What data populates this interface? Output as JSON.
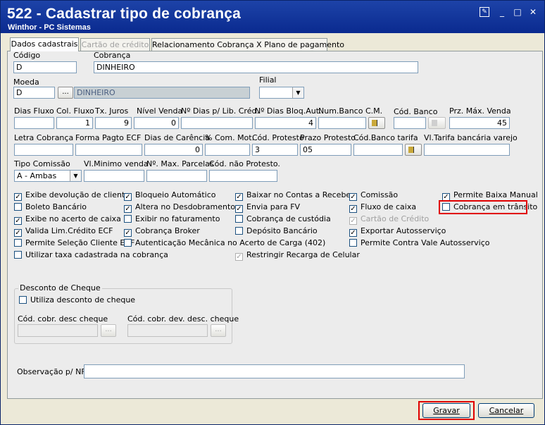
{
  "window": {
    "title": "522 - Cadastrar tipo de cobrança",
    "subtitle": "Winthor - PC Sistemas"
  },
  "tabs": [
    "Dados cadastrais",
    "Cartão de crédito",
    "Relacionamento Cobrança X Plano de pagamento"
  ],
  "fields": {
    "codigo": {
      "label": "Código",
      "value": "D"
    },
    "cobranca": {
      "label": "Cobrança",
      "value": "DINHEIRO"
    },
    "moeda": {
      "label": "Moeda",
      "value": "D",
      "desc": "DINHEIRO"
    },
    "filial": {
      "label": "Filial",
      "value": ""
    },
    "dias_fluxo": {
      "label": "Dias Fluxo",
      "value": ""
    },
    "col_fluxo": {
      "label": "Col. Fluxo",
      "value": "1"
    },
    "tx_juros": {
      "label": "Tx. Juros",
      "value": "9"
    },
    "nivel_venda": {
      "label": "Nível Venda",
      "value": "0"
    },
    "dias_lib_cred": {
      "label": "Nº Dias p/ Lib. Créd.",
      "value": ""
    },
    "dias_bloq_aut": {
      "label": "Nº Dias Bloq.Aut.",
      "value": "4"
    },
    "num_banco_cm": {
      "label": "Num.Banco C.M.",
      "value": ""
    },
    "cod_banco": {
      "label": "Cód. Banco",
      "value": ""
    },
    "prz_max_venda": {
      "label": "Prz. Máx. Venda",
      "value": "45"
    },
    "letra_cobranca": {
      "label": "Letra Cobrança",
      "value": ""
    },
    "forma_pagto_ecf": {
      "label": "Forma Pagto ECF",
      "value": ""
    },
    "dias_carencia": {
      "label": "Dias de Carência",
      "value": "0"
    },
    "com_mot": {
      "label": "% Com. Mot.",
      "value": ""
    },
    "cod_protesto": {
      "label": "Cód. Protesto",
      "value": "3"
    },
    "prazo_protesto": {
      "label": "Prazo Protesto",
      "value": "05"
    },
    "cod_banco_tarifa": {
      "label": "Cód.Banco tarifa",
      "value": ""
    },
    "vl_tarifa_bancaria": {
      "label": "Vl.Tarifa bancária varejo",
      "value": ""
    },
    "tipo_comissao": {
      "label": "Tipo Comissão",
      "value": "A - Ambas"
    },
    "vl_minimo_venda": {
      "label": "Vl.Minimo venda",
      "value": ""
    },
    "max_parcelas": {
      "label": "Nº. Max. Parcelas",
      "value": ""
    },
    "cod_nao_protesto": {
      "label": "Cód. não  Protesto.",
      "value": ""
    },
    "observacao_nf": {
      "label": "Observação p/ NF:",
      "value": ""
    }
  },
  "checkboxes": [
    {
      "label": "Exibe devolução de cliente",
      "checked": true,
      "disabled": false
    },
    {
      "label": "Boleto Bancário",
      "checked": false,
      "disabled": false
    },
    {
      "label": "Exibe no acerto de caixa",
      "checked": true,
      "disabled": false
    },
    {
      "label": "Valida Lim.Crédito ECF",
      "checked": true,
      "disabled": false
    },
    {
      "label": "Permite Seleção Cliente ECF",
      "checked": false,
      "disabled": false
    },
    {
      "label": "Utilizar taxa cadastrada na cobrança",
      "checked": false,
      "disabled": false
    },
    {
      "label": "Bloqueio Automático",
      "checked": true,
      "disabled": false
    },
    {
      "label": "Altera no Desdobramento",
      "checked": true,
      "disabled": false
    },
    {
      "label": "Exibir no faturamento",
      "checked": false,
      "disabled": false
    },
    {
      "label": "Cobrança Broker",
      "checked": true,
      "disabled": false
    },
    {
      "label": "Autenticação Mecânica no Acerto de Carga (402)",
      "checked": false,
      "disabled": false
    },
    {
      "label": "Baixar no Contas a Receber",
      "checked": true,
      "disabled": false
    },
    {
      "label": "Envia para FV",
      "checked": true,
      "disabled": false
    },
    {
      "label": "Cobrança de custódia",
      "checked": false,
      "disabled": false
    },
    {
      "label": "Depósito Bancário",
      "checked": false,
      "disabled": false
    },
    {
      "label": "Permite Contra Vale Autosserviço",
      "checked": false,
      "disabled": false
    },
    {
      "label": "Restringir Recarga de Celular",
      "checked": true,
      "disabled": true
    },
    {
      "label": "Comissão",
      "checked": true,
      "disabled": false
    },
    {
      "label": "Fluxo de caixa",
      "checked": true,
      "disabled": false
    },
    {
      "label": "Cartão de Crédito",
      "checked": true,
      "disabled": true
    },
    {
      "label": "Exportar Autosserviço",
      "checked": true,
      "disabled": false
    },
    {
      "label": "Permite Baixa Manual",
      "checked": true,
      "disabled": false
    },
    {
      "label": "Cobrança em trânsito",
      "checked": false,
      "disabled": false
    }
  ],
  "desconto_cheque": {
    "group_label": "Desconto de Cheque",
    "utiliza_label": "Utiliza desconto de cheque",
    "utiliza_checked": false,
    "cod_desc_label": "Cód. cobr. desc cheque",
    "cod_desc_value": "",
    "cod_dev_label": "Cód. cobr. dev. desc. cheque",
    "cod_dev_value": ""
  },
  "ellipsis": "...",
  "buttons": {
    "save": "Gravar",
    "cancel": "Cancelar"
  },
  "window_controls": {
    "minimize": "_",
    "maximize": "□",
    "close": "✕",
    "edit": "✎"
  },
  "colors": {
    "title_bar": "#0a2a8f",
    "highlight": "#e00000",
    "disabled_text": "#a0a0a0"
  }
}
